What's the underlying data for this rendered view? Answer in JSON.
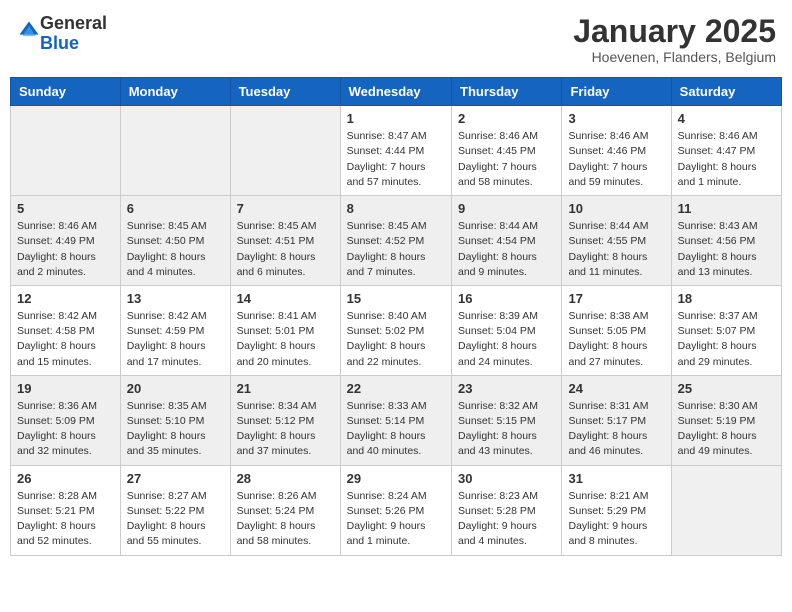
{
  "logo": {
    "general": "General",
    "blue": "Blue"
  },
  "header": {
    "month": "January 2025",
    "location": "Hoevenen, Flanders, Belgium"
  },
  "weekdays": [
    "Sunday",
    "Monday",
    "Tuesday",
    "Wednesday",
    "Thursday",
    "Friday",
    "Saturday"
  ],
  "weeks": [
    [
      {
        "day": "",
        "info": ""
      },
      {
        "day": "",
        "info": ""
      },
      {
        "day": "",
        "info": ""
      },
      {
        "day": "1",
        "info": "Sunrise: 8:47 AM\nSunset: 4:44 PM\nDaylight: 7 hours\nand 57 minutes."
      },
      {
        "day": "2",
        "info": "Sunrise: 8:46 AM\nSunset: 4:45 PM\nDaylight: 7 hours\nand 58 minutes."
      },
      {
        "day": "3",
        "info": "Sunrise: 8:46 AM\nSunset: 4:46 PM\nDaylight: 7 hours\nand 59 minutes."
      },
      {
        "day": "4",
        "info": "Sunrise: 8:46 AM\nSunset: 4:47 PM\nDaylight: 8 hours\nand 1 minute."
      }
    ],
    [
      {
        "day": "5",
        "info": "Sunrise: 8:46 AM\nSunset: 4:49 PM\nDaylight: 8 hours\nand 2 minutes."
      },
      {
        "day": "6",
        "info": "Sunrise: 8:45 AM\nSunset: 4:50 PM\nDaylight: 8 hours\nand 4 minutes."
      },
      {
        "day": "7",
        "info": "Sunrise: 8:45 AM\nSunset: 4:51 PM\nDaylight: 8 hours\nand 6 minutes."
      },
      {
        "day": "8",
        "info": "Sunrise: 8:45 AM\nSunset: 4:52 PM\nDaylight: 8 hours\nand 7 minutes."
      },
      {
        "day": "9",
        "info": "Sunrise: 8:44 AM\nSunset: 4:54 PM\nDaylight: 8 hours\nand 9 minutes."
      },
      {
        "day": "10",
        "info": "Sunrise: 8:44 AM\nSunset: 4:55 PM\nDaylight: 8 hours\nand 11 minutes."
      },
      {
        "day": "11",
        "info": "Sunrise: 8:43 AM\nSunset: 4:56 PM\nDaylight: 8 hours\nand 13 minutes."
      }
    ],
    [
      {
        "day": "12",
        "info": "Sunrise: 8:42 AM\nSunset: 4:58 PM\nDaylight: 8 hours\nand 15 minutes."
      },
      {
        "day": "13",
        "info": "Sunrise: 8:42 AM\nSunset: 4:59 PM\nDaylight: 8 hours\nand 17 minutes."
      },
      {
        "day": "14",
        "info": "Sunrise: 8:41 AM\nSunset: 5:01 PM\nDaylight: 8 hours\nand 20 minutes."
      },
      {
        "day": "15",
        "info": "Sunrise: 8:40 AM\nSunset: 5:02 PM\nDaylight: 8 hours\nand 22 minutes."
      },
      {
        "day": "16",
        "info": "Sunrise: 8:39 AM\nSunset: 5:04 PM\nDaylight: 8 hours\nand 24 minutes."
      },
      {
        "day": "17",
        "info": "Sunrise: 8:38 AM\nSunset: 5:05 PM\nDaylight: 8 hours\nand 27 minutes."
      },
      {
        "day": "18",
        "info": "Sunrise: 8:37 AM\nSunset: 5:07 PM\nDaylight: 8 hours\nand 29 minutes."
      }
    ],
    [
      {
        "day": "19",
        "info": "Sunrise: 8:36 AM\nSunset: 5:09 PM\nDaylight: 8 hours\nand 32 minutes."
      },
      {
        "day": "20",
        "info": "Sunrise: 8:35 AM\nSunset: 5:10 PM\nDaylight: 8 hours\nand 35 minutes."
      },
      {
        "day": "21",
        "info": "Sunrise: 8:34 AM\nSunset: 5:12 PM\nDaylight: 8 hours\nand 37 minutes."
      },
      {
        "day": "22",
        "info": "Sunrise: 8:33 AM\nSunset: 5:14 PM\nDaylight: 8 hours\nand 40 minutes."
      },
      {
        "day": "23",
        "info": "Sunrise: 8:32 AM\nSunset: 5:15 PM\nDaylight: 8 hours\nand 43 minutes."
      },
      {
        "day": "24",
        "info": "Sunrise: 8:31 AM\nSunset: 5:17 PM\nDaylight: 8 hours\nand 46 minutes."
      },
      {
        "day": "25",
        "info": "Sunrise: 8:30 AM\nSunset: 5:19 PM\nDaylight: 8 hours\nand 49 minutes."
      }
    ],
    [
      {
        "day": "26",
        "info": "Sunrise: 8:28 AM\nSunset: 5:21 PM\nDaylight: 8 hours\nand 52 minutes."
      },
      {
        "day": "27",
        "info": "Sunrise: 8:27 AM\nSunset: 5:22 PM\nDaylight: 8 hours\nand 55 minutes."
      },
      {
        "day": "28",
        "info": "Sunrise: 8:26 AM\nSunset: 5:24 PM\nDaylight: 8 hours\nand 58 minutes."
      },
      {
        "day": "29",
        "info": "Sunrise: 8:24 AM\nSunset: 5:26 PM\nDaylight: 9 hours\nand 1 minute."
      },
      {
        "day": "30",
        "info": "Sunrise: 8:23 AM\nSunset: 5:28 PM\nDaylight: 9 hours\nand 4 minutes."
      },
      {
        "day": "31",
        "info": "Sunrise: 8:21 AM\nSunset: 5:29 PM\nDaylight: 9 hours\nand 8 minutes."
      },
      {
        "day": "",
        "info": ""
      }
    ]
  ]
}
